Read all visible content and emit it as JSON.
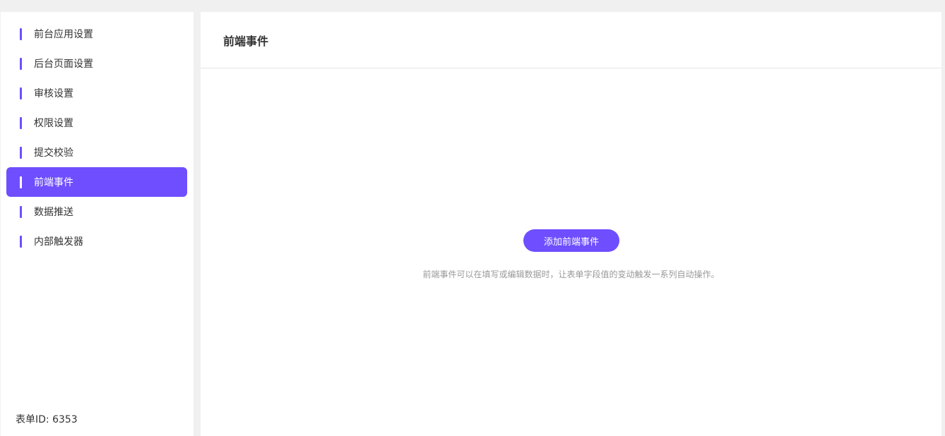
{
  "sidebar": {
    "items": [
      {
        "label": "前台应用设置"
      },
      {
        "label": "后台页面设置"
      },
      {
        "label": "审核设置"
      },
      {
        "label": "权限设置"
      },
      {
        "label": "提交校验"
      },
      {
        "label": "前端事件",
        "active": true
      },
      {
        "label": "数据推送"
      },
      {
        "label": "内部触发器"
      }
    ],
    "form_id": "表单ID: 6353"
  },
  "main": {
    "title": "前端事件",
    "add_button": "添加前端事件",
    "hint": "前端事件可以在填写或编辑数据时，让表单字段值的变动触发一系列自动操作。"
  },
  "colors": {
    "accent": "#6f4eff"
  }
}
